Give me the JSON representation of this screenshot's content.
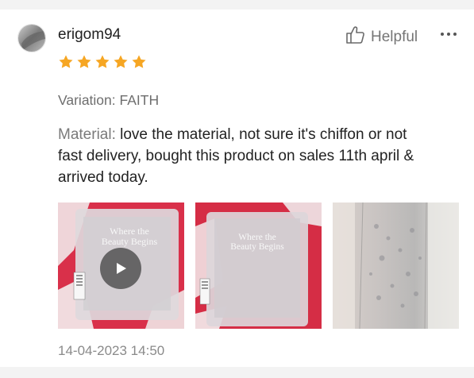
{
  "review": {
    "username": "erigom94",
    "rating": 5,
    "helpful_label": "Helpful",
    "variation": "Variation: FAITH",
    "material_label": "Material:",
    "material_text": " love the material, not sure it's chiffon or not",
    "body_text": "fast delivery, bought this product on sales 11th april & arrived today.",
    "timestamp": "14-04-2023 14:50",
    "package_text_line1": "Where the",
    "package_text_line2": "Beauty Begins"
  },
  "colors": {
    "star": "#f6a623",
    "text_muted": "#757575",
    "red_fabric": "#d9304a"
  },
  "icons": {
    "helpful": "thumbs-up-icon",
    "more": "more-dots-icon",
    "play": "play-icon"
  }
}
